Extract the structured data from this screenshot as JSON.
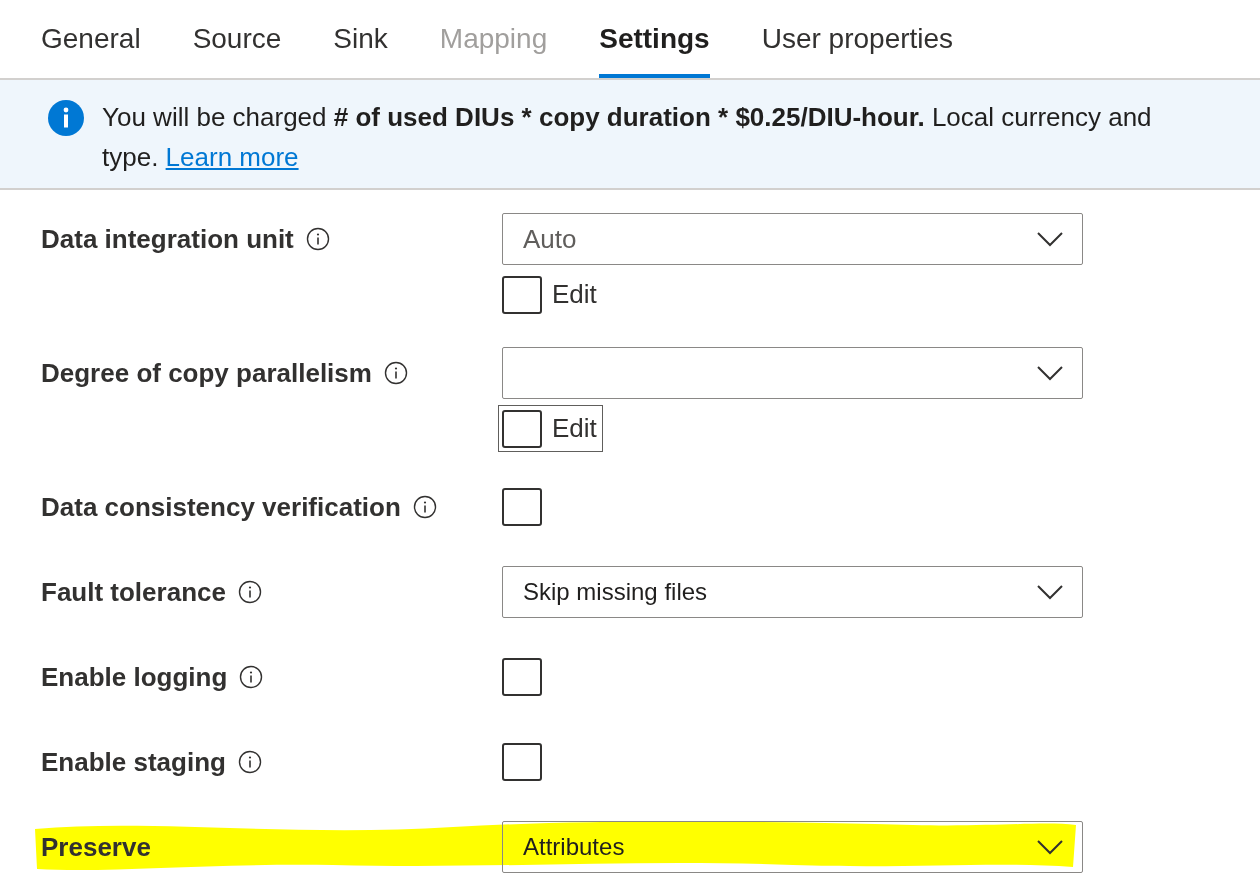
{
  "tabs": [
    {
      "label": "General",
      "selected": false,
      "disabled": false
    },
    {
      "label": "Source",
      "selected": false,
      "disabled": false
    },
    {
      "label": "Sink",
      "selected": false,
      "disabled": false
    },
    {
      "label": "Mapping",
      "selected": false,
      "disabled": true
    },
    {
      "label": "Settings",
      "selected": true,
      "disabled": false
    },
    {
      "label": "User properties",
      "selected": false,
      "disabled": false
    }
  ],
  "banner": {
    "lines": [
      "You will be charged **# of used DIUs * copy duration * $0.25/DIU-hour.** Local currency and",
      "type."
    ],
    "link": "Learn more"
  },
  "fields": [
    {
      "label": "Data integration unit",
      "info": true,
      "kind": "dropdown",
      "value": "Auto",
      "placeholder_style": true,
      "highlighted": false,
      "edit": {
        "label": "Edit",
        "checked": false,
        "focused": false
      }
    },
    {
      "label": "Degree of copy parallelism",
      "info": true,
      "kind": "dropdown",
      "highlighted": false,
      "edit": {
        "label": "Edit",
        "checked": false,
        "focused": true
      }
    },
    {
      "label": "Data consistency verification",
      "info": true,
      "kind": "checkbox",
      "checked": false,
      "highlighted": false
    },
    {
      "label": "Fault tolerance",
      "info": true,
      "kind": "dropdown",
      "value": "Skip missing files",
      "highlighted": false
    },
    {
      "label": "Enable logging",
      "info": true,
      "kind": "checkbox",
      "checked": false,
      "highlighted": false
    },
    {
      "label": "Enable staging",
      "info": true,
      "kind": "checkbox",
      "checked": false,
      "highlighted": false
    },
    {
      "label": "Preserve",
      "info": false,
      "kind": "dropdown",
      "value": "Attributes",
      "highlighted": true
    }
  ]
}
